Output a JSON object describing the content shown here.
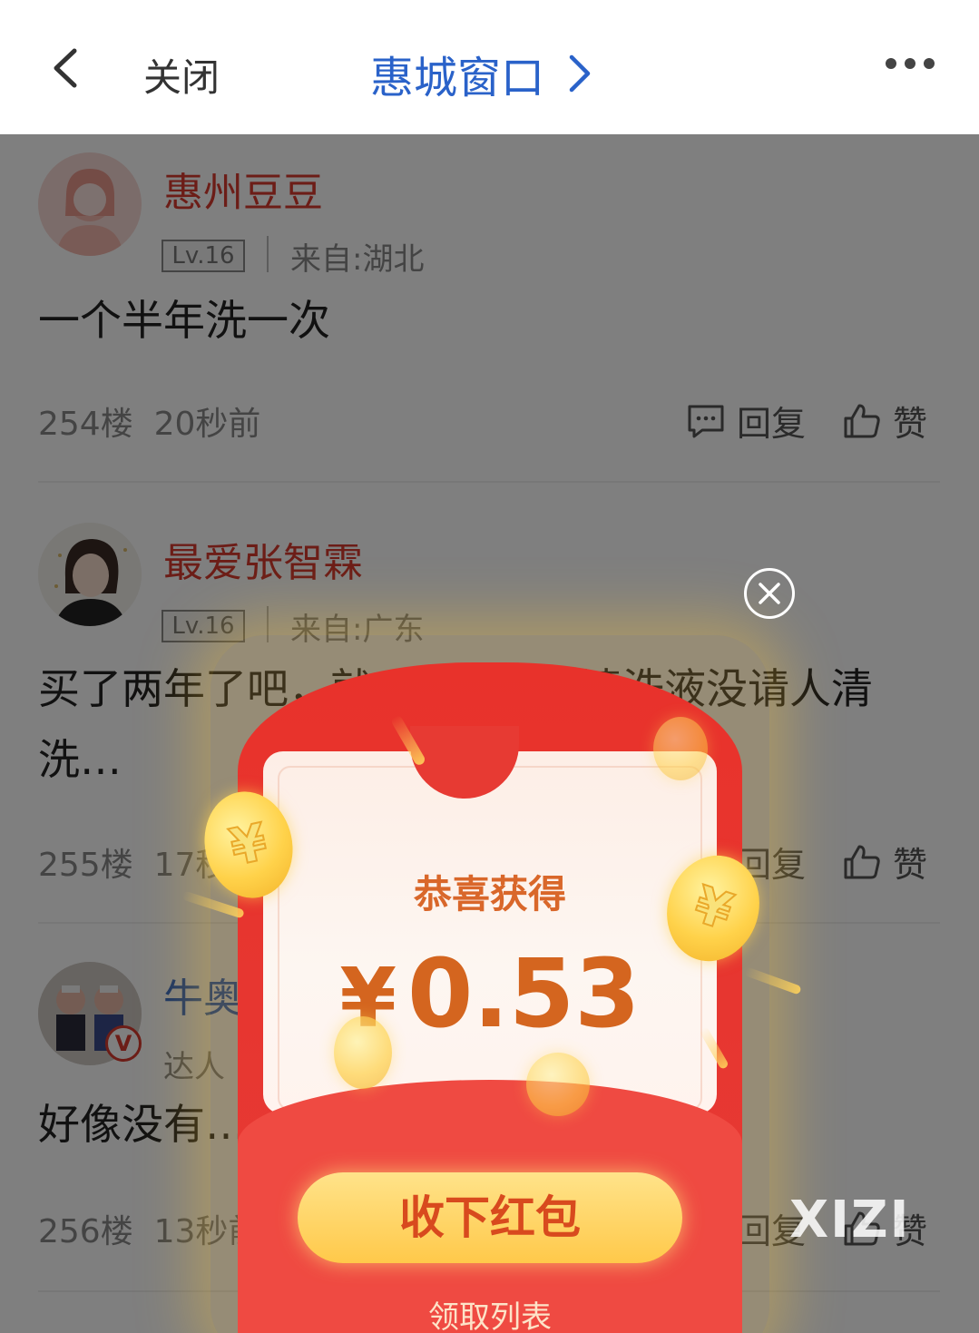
{
  "header": {
    "close_label": "关闭",
    "title": "惠城窗口"
  },
  "comments": [
    {
      "username": "惠州豆豆",
      "level": "Lv.16",
      "from": "来自:湖北",
      "text": "一个半年洗一次",
      "floor": "254楼",
      "time": "20秒前",
      "reply_label": "回复",
      "like_label": "赞"
    },
    {
      "username": "最爱张智霖",
      "level": "Lv.16",
      "from": "来自:广东",
      "text": "买了两年了吧，就……买那种清洗液没请人清洗…",
      "floor": "255楼",
      "time": "17秒前",
      "reply_label": "回复",
      "like_label": "赞"
    },
    {
      "username": "牛奥…",
      "badge": "达人",
      "text": "好像没有…",
      "floor": "256楼",
      "time": "13秒前",
      "reply_label": "回复",
      "like_label": "赞"
    }
  ],
  "red_packet": {
    "congrats": "恭喜获得",
    "currency": "¥",
    "amount": "0.53",
    "receive_label": "收下红包",
    "list_label": "领取列表"
  },
  "watermark": "XIZI",
  "colors": {
    "title_blue": "#2a62c9",
    "username_red": "#d83a2f",
    "packet_red": "#e8322b",
    "gold": "#ffc94a"
  }
}
